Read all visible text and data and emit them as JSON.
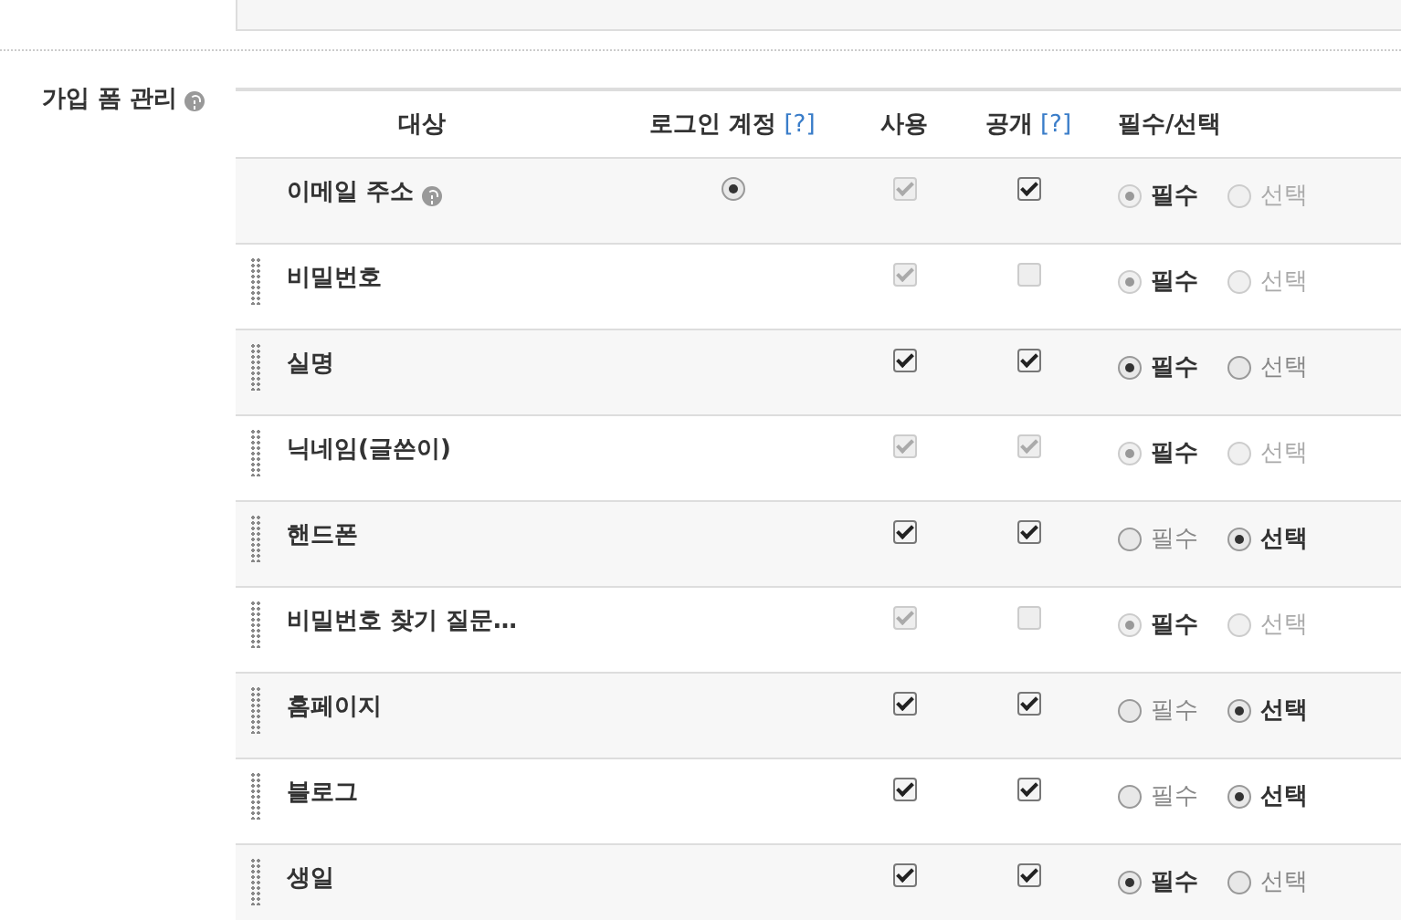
{
  "section": {
    "label": "가입 폼 관리"
  },
  "columns": [
    {
      "label": "대상"
    },
    {
      "label": "로그인 계정",
      "help": "[?]"
    },
    {
      "label": "사용"
    },
    {
      "label": "공개",
      "help": "[?]"
    },
    {
      "label": "필수/선택"
    }
  ],
  "rows": [
    {
      "name": "이메일 주소",
      "draggable": false,
      "help": true,
      "login": {
        "selected": true
      },
      "use": {
        "checked": true,
        "disabled": true
      },
      "public": {
        "checked": true,
        "disabled": false
      },
      "disabled": true,
      "options": [
        {
          "label": "필수",
          "selected": true
        },
        {
          "label": "선택",
          "selected": false
        }
      ]
    },
    {
      "name": "비밀번호",
      "draggable": true,
      "help": false,
      "use": {
        "checked": true,
        "disabled": true
      },
      "public": {
        "checked": false,
        "disabled": true
      },
      "disabled": true,
      "options": [
        {
          "label": "필수",
          "selected": true
        },
        {
          "label": "선택",
          "selected": false
        }
      ]
    },
    {
      "name": "실명",
      "draggable": true,
      "help": false,
      "use": {
        "checked": true,
        "disabled": false
      },
      "public": {
        "checked": true,
        "disabled": false
      },
      "disabled": false,
      "options": [
        {
          "label": "필수",
          "selected": true
        },
        {
          "label": "선택",
          "selected": false
        }
      ]
    },
    {
      "name": "닉네임(글쓴이)",
      "draggable": true,
      "help": false,
      "use": {
        "checked": true,
        "disabled": true
      },
      "public": {
        "checked": true,
        "disabled": true
      },
      "disabled": true,
      "options": [
        {
          "label": "필수",
          "selected": true
        },
        {
          "label": "선택",
          "selected": false
        }
      ]
    },
    {
      "name": "핸드폰",
      "draggable": true,
      "help": false,
      "use": {
        "checked": true,
        "disabled": false
      },
      "public": {
        "checked": true,
        "disabled": false
      },
      "disabled": false,
      "options": [
        {
          "label": "필수",
          "selected": false
        },
        {
          "label": "선택",
          "selected": true
        }
      ]
    },
    {
      "name": "비밀번호 찾기 질문…",
      "draggable": true,
      "help": false,
      "use": {
        "checked": true,
        "disabled": true
      },
      "public": {
        "checked": false,
        "disabled": true
      },
      "disabled": true,
      "options": [
        {
          "label": "필수",
          "selected": true
        },
        {
          "label": "선택",
          "selected": false
        }
      ]
    },
    {
      "name": "홈페이지",
      "draggable": true,
      "help": false,
      "use": {
        "checked": true,
        "disabled": false
      },
      "public": {
        "checked": true,
        "disabled": false
      },
      "disabled": false,
      "options": [
        {
          "label": "필수",
          "selected": false
        },
        {
          "label": "선택",
          "selected": true
        }
      ]
    },
    {
      "name": "블로그",
      "draggable": true,
      "help": false,
      "use": {
        "checked": true,
        "disabled": false
      },
      "public": {
        "checked": true,
        "disabled": false
      },
      "disabled": false,
      "options": [
        {
          "label": "필수",
          "selected": false
        },
        {
          "label": "선택",
          "selected": true
        }
      ]
    },
    {
      "name": "생일",
      "draggable": true,
      "help": false,
      "use": {
        "checked": true,
        "disabled": false
      },
      "public": {
        "checked": true,
        "disabled": false
      },
      "disabled": false,
      "options": [
        {
          "label": "필수",
          "selected": true
        },
        {
          "label": "선택",
          "selected": false
        }
      ]
    }
  ]
}
